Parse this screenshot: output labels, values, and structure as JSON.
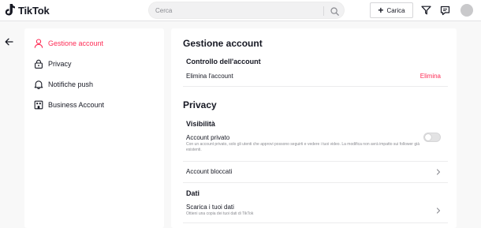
{
  "header": {
    "app_name": "TikTok",
    "search_placeholder": "Cerca",
    "upload_label": "Carica",
    "upload_plus": "+"
  },
  "sidebar": {
    "items": [
      {
        "label": "Gestione account",
        "icon": "person-icon",
        "active": true
      },
      {
        "label": "Privacy",
        "icon": "lock-icon",
        "active": false
      },
      {
        "label": "Notifiche push",
        "icon": "bell-icon",
        "active": false
      },
      {
        "label": "Business Account",
        "icon": "business-icon",
        "active": false
      }
    ]
  },
  "main": {
    "account_section": {
      "title": "Gestione account",
      "subtitle": "Controllo dell'account",
      "delete_label": "Elimina l'account",
      "delete_action": "Elimina"
    },
    "privacy_section": {
      "title": "Privacy",
      "visibility_subtitle": "Visibilità",
      "private_account_label": "Account privato",
      "private_account_desc": "Con un account privato, solo gli utenti che approvi possono seguirti e vedere i tuoi video. La modifica non avrà impatto sui follower già esistenti.",
      "private_account_enabled": false,
      "blocked_label": "Account bloccati",
      "data_subtitle": "Dati",
      "download_label": "Scarica i tuoi dati",
      "download_desc": "Ottieni una copia dei tuoi dati di TikTok"
    }
  },
  "colors": {
    "accent": "#fe2c55",
    "text": "#161823",
    "muted": "#8a8b91",
    "background": "#f8f8f8"
  }
}
